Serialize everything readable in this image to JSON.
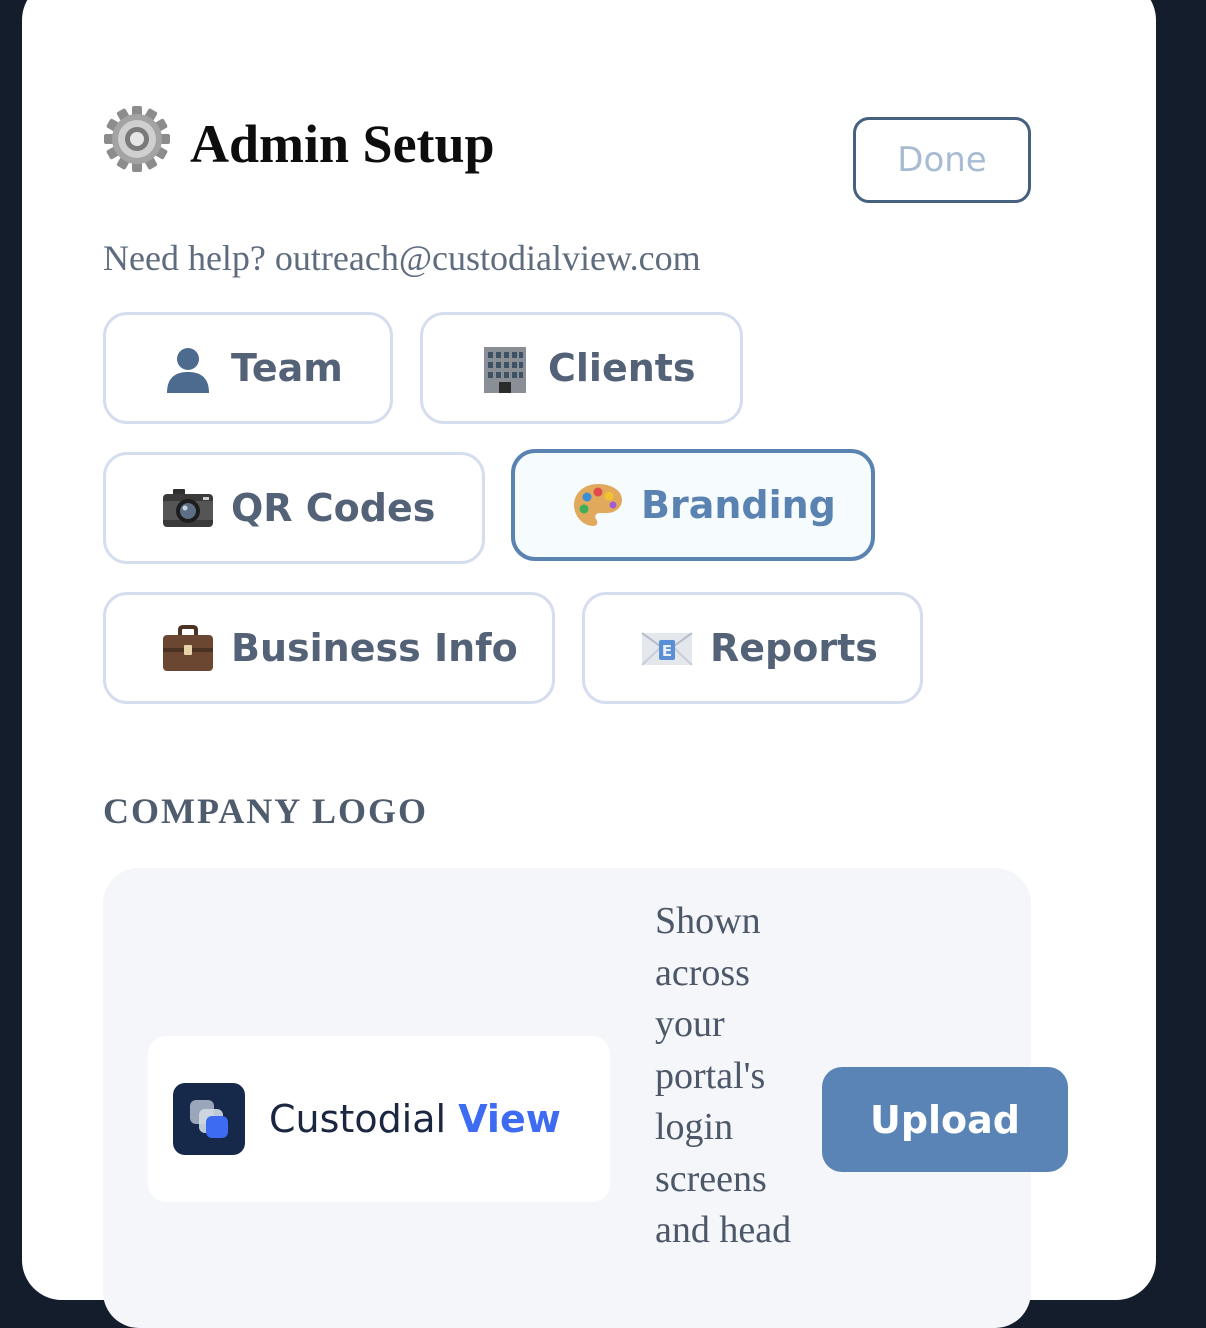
{
  "header": {
    "title": "Admin Setup",
    "title_icon": "gear-icon",
    "done_label": "Done",
    "help_text": "Need help? outreach@custodialview.com"
  },
  "tabs": [
    {
      "label": "Team",
      "icon": "bust-silhouette-icon",
      "active": false
    },
    {
      "label": "Clients",
      "icon": "office-building-icon",
      "active": false
    },
    {
      "label": "QR Codes",
      "icon": "camera-icon",
      "active": false
    },
    {
      "label": "Branding",
      "icon": "artist-palette-icon",
      "active": true
    },
    {
      "label": "Business Info",
      "icon": "briefcase-icon",
      "active": false
    },
    {
      "label": "Reports",
      "icon": "email-icon",
      "active": false
    }
  ],
  "logo_section": {
    "label": "COMPANY LOGO",
    "logo_name_part1": "Custodial",
    "logo_name_part2": "View",
    "description": "Shown across your portal's login screens and head",
    "upload_label": "Upload"
  },
  "colors": {
    "background": "#131d2c",
    "accent": "#5a84b5",
    "active_tab_border": "#5b83b2",
    "tab_border": "#d6ddee"
  }
}
